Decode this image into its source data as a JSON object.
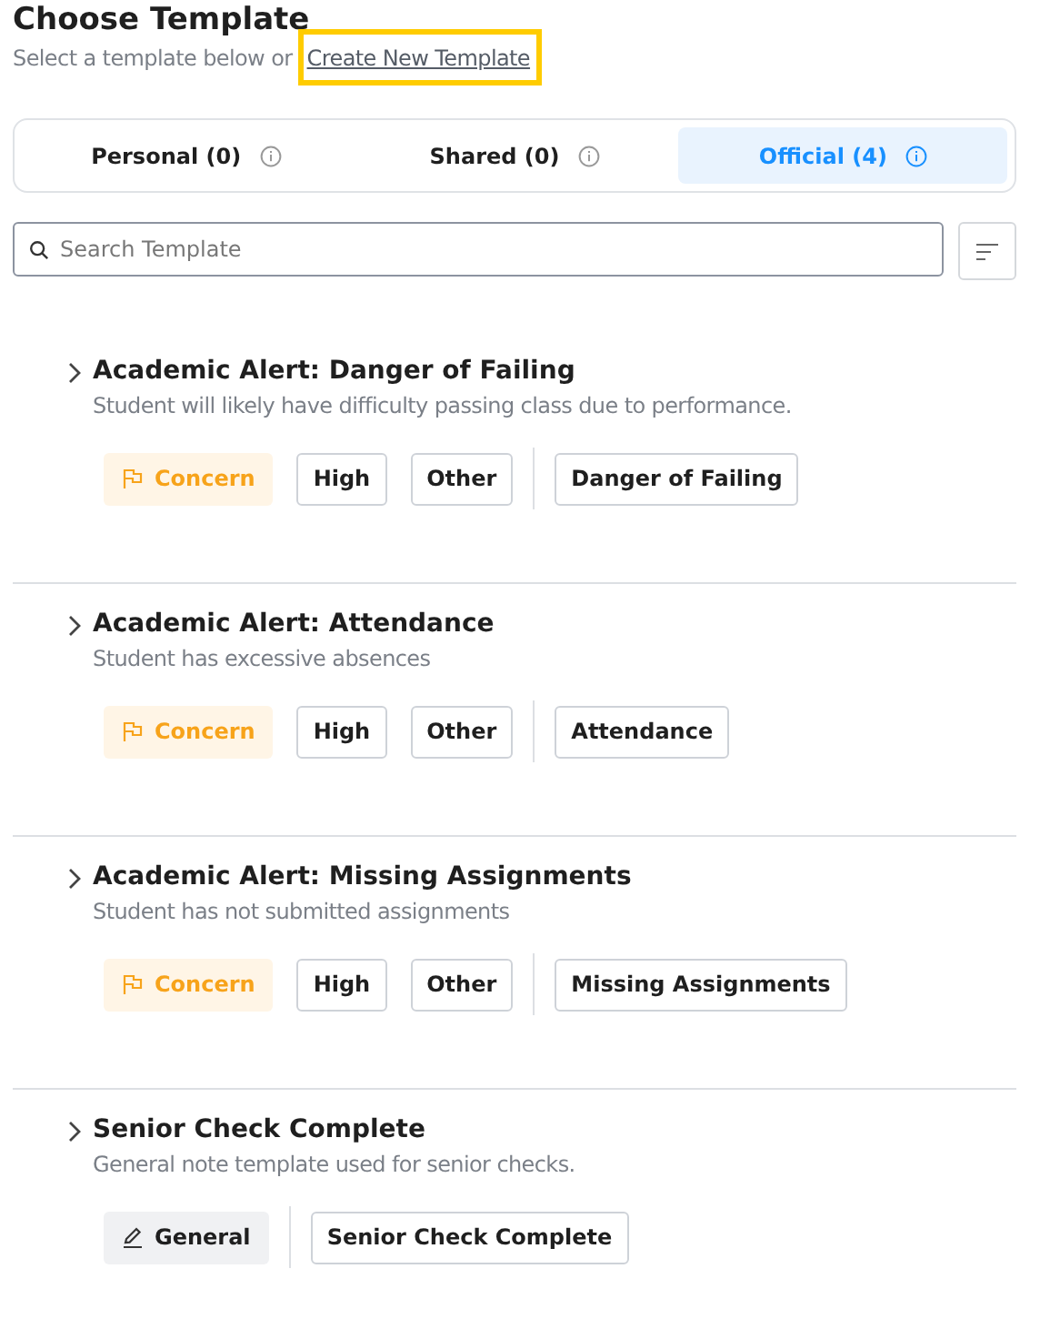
{
  "header": {
    "title": "Choose Template",
    "subtitle": "Select a template below or",
    "link": "Create New Template",
    "link_highlighted": true
  },
  "tabs": [
    {
      "label": "Personal (0)",
      "selected": false
    },
    {
      "label": "Shared (0)",
      "selected": false
    },
    {
      "label": "Official (4)",
      "selected": true
    }
  ],
  "search": {
    "placeholder": "Search Template"
  },
  "templates": [
    {
      "title": "Academic Alert: Danger of Failing",
      "description": "Student will likely have difficulty passing class due to performance.",
      "expanded": false,
      "category": {
        "label": "Concern",
        "kind": "concern"
      },
      "tags": [
        "High",
        "Other"
      ],
      "topic": "Danger of Failing"
    },
    {
      "title": "Academic Alert: Attendance",
      "description": "Student has excessive absences",
      "expanded": false,
      "category": {
        "label": "Concern",
        "kind": "concern"
      },
      "tags": [
        "High",
        "Other"
      ],
      "topic": "Attendance"
    },
    {
      "title": "Academic Alert: Missing Assignments",
      "description": "Student has not submitted assignments",
      "expanded": false,
      "category": {
        "label": "Concern",
        "kind": "concern"
      },
      "tags": [
        "High",
        "Other"
      ],
      "topic": "Missing Assignments"
    },
    {
      "title": "Senior Check Complete",
      "description": "General note template used for senior checks.",
      "expanded": false,
      "category": {
        "label": "General",
        "kind": "general"
      },
      "topic": "Senior Check Complete"
    }
  ]
}
